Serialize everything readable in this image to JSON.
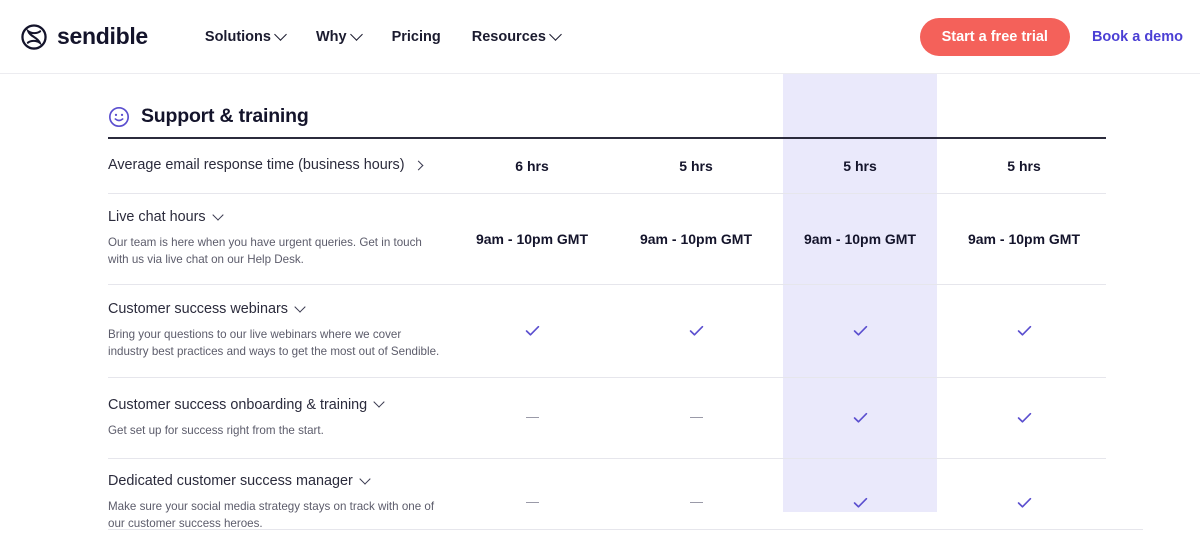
{
  "header": {
    "brand_name": "sendible",
    "logo_icon": "sendible-s-circle-logo",
    "nav": [
      {
        "label": "Solutions",
        "has_dropdown": true
      },
      {
        "label": "Why",
        "has_dropdown": true
      },
      {
        "label": "Pricing",
        "has_dropdown": false
      },
      {
        "label": "Resources",
        "has_dropdown": true
      }
    ],
    "cta_label": "Start a free trial",
    "demo_label": "Book a demo",
    "cta_color": "#f4615a",
    "link_color": "#4b3fd4"
  },
  "section": {
    "icon": "smiley-face-icon",
    "title": "Support & training",
    "accent_color": "#5b4fcf",
    "highlight_color": "#eae9fb"
  },
  "rows": [
    {
      "title": "Average email response time (business hours)",
      "toggle_icon": "chevron-right-icon",
      "description": "",
      "values": [
        "6 hrs",
        "5 hrs",
        "5 hrs",
        "5 hrs"
      ],
      "types": [
        "text",
        "text",
        "text",
        "text"
      ]
    },
    {
      "title": "Live chat hours",
      "toggle_icon": "chevron-down-icon",
      "description": "Our team is here when you have urgent queries. Get in touch with us via live chat on our Help Desk.",
      "values": [
        "9am - 10pm GMT",
        "9am - 10pm GMT",
        "9am - 10pm GMT",
        "9am - 10pm GMT"
      ],
      "types": [
        "text",
        "text",
        "text",
        "text"
      ]
    },
    {
      "title": "Customer success webinars",
      "toggle_icon": "chevron-down-icon",
      "description": "Bring your questions to our live webinars where we cover industry best practices and ways to get the most out of Sendible.",
      "values": [
        "check",
        "check",
        "check",
        "check"
      ],
      "types": [
        "check",
        "check",
        "check",
        "check"
      ]
    },
    {
      "title": "Customer success onboarding & training",
      "toggle_icon": "chevron-down-icon",
      "description": "Get set up for success right from the start.",
      "values": [
        "dash",
        "dash",
        "check",
        "check"
      ],
      "types": [
        "dash",
        "dash",
        "check",
        "check"
      ]
    },
    {
      "title": "Dedicated customer success manager",
      "toggle_icon": "chevron-down-icon",
      "description": "Make sure your social media strategy stays on track with one of our customer success heroes.",
      "values": [
        "dash",
        "dash",
        "check",
        "check"
      ],
      "types": [
        "dash",
        "dash",
        "check",
        "check"
      ]
    }
  ]
}
